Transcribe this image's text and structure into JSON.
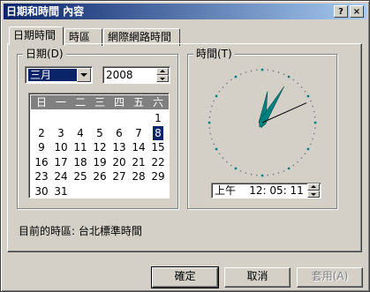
{
  "window": {
    "title": "日期和時間 內容",
    "help_button": "?",
    "close_button": "×"
  },
  "tabs": [
    {
      "label": "日期時間",
      "active": true
    },
    {
      "label": "時區",
      "active": false
    },
    {
      "label": "網際網路時間",
      "active": false
    }
  ],
  "date_group": {
    "label": "日期(D)",
    "month": "三月",
    "year": "2008",
    "weekdays": [
      "日",
      "一",
      "二",
      "三",
      "四",
      "五",
      "六"
    ],
    "weeks": [
      [
        "",
        "",
        "",
        "",
        "",
        "",
        "1"
      ],
      [
        "2",
        "3",
        "4",
        "5",
        "6",
        "7",
        "8"
      ],
      [
        "9",
        "10",
        "11",
        "12",
        "13",
        "14",
        "15"
      ],
      [
        "16",
        "17",
        "18",
        "19",
        "20",
        "21",
        "22"
      ],
      [
        "23",
        "24",
        "25",
        "26",
        "27",
        "28",
        "29"
      ],
      [
        "30",
        "31",
        "",
        "",
        "",
        "",
        ""
      ]
    ],
    "selected_day": "8"
  },
  "time_group": {
    "label": "時間(T)",
    "ampm": "上午",
    "time": "12: 05: 11",
    "clock": {
      "hour": 12,
      "minute": 5,
      "second": 11
    }
  },
  "timezone_text": "目前的時區: 台北標準時間",
  "buttons": {
    "ok": "確定",
    "cancel": "取消",
    "apply": "套用(A)"
  },
  "colors": {
    "title_bar": "#0a246a",
    "face": "#d4d0c8",
    "clock_hands": "#008080",
    "selection": "#0a246a"
  }
}
